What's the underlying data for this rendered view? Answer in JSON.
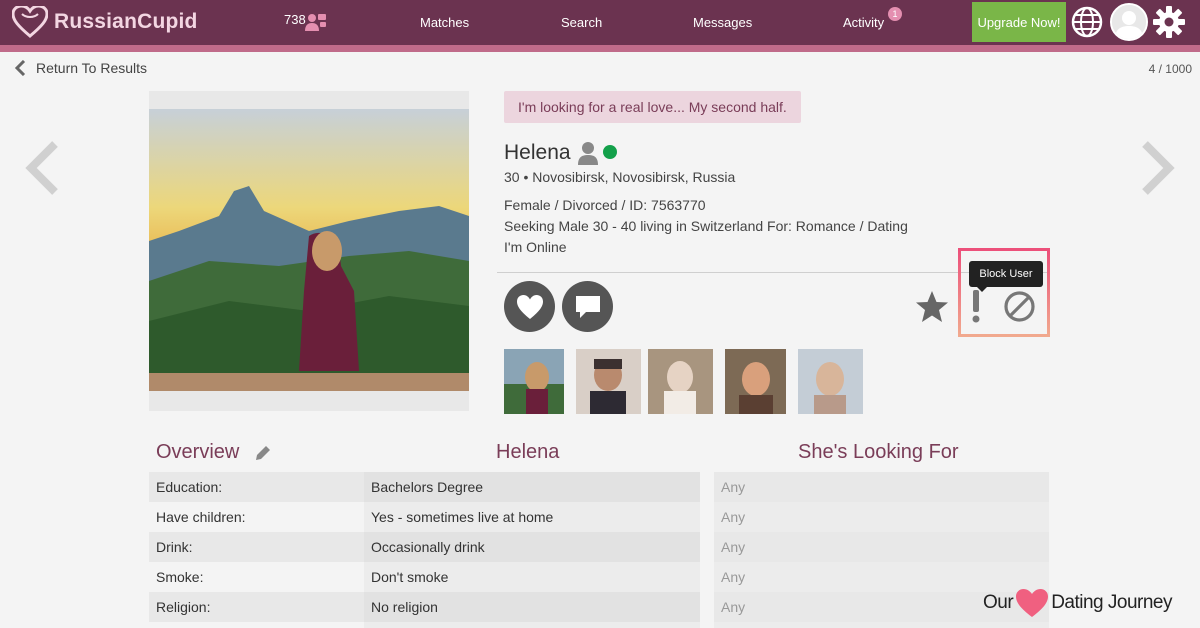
{
  "nav": {
    "logo_text": "RussianCupid",
    "count": "738",
    "matches": "Matches",
    "search": "Search",
    "messages": "Messages",
    "activity": "Activity",
    "activity_badge": "1",
    "upgrade": "Upgrade Now!",
    "icons": [
      "heart-logo-icon",
      "people-icon",
      "globe-icon",
      "avatar-icon",
      "gear-icon"
    ]
  },
  "subheader": {
    "back": "Return To Results",
    "pager": "4 / 1000"
  },
  "profile": {
    "tagline": "I'm looking for a real love... My second half.",
    "name": "Helena",
    "location": "30 • Novosibirsk, Novosibirsk, Russia",
    "details": "Female / Divorced / ID: 7563770",
    "seeking": "Seeking Male 30 - 40 living in Switzerland For: Romance / Dating",
    "status": "I'm Online"
  },
  "actions": {
    "tooltip": "Block User"
  },
  "columns": {
    "overview": "Overview",
    "her": "Helena",
    "looking": "She's Looking For"
  },
  "rows": [
    {
      "label": "Education:",
      "value": "Bachelors Degree",
      "want": "Any"
    },
    {
      "label": "Have children:",
      "value": "Yes - sometimes live at home",
      "want": "Any"
    },
    {
      "label": "Drink:",
      "value": "Occasionally drink",
      "want": "Any"
    },
    {
      "label": "Smoke:",
      "value": "Don't smoke",
      "want": "Any"
    },
    {
      "label": "Religion:",
      "value": "No religion",
      "want": "Any"
    }
  ],
  "watermark": {
    "left": "Our",
    "right": "Dating Journey"
  },
  "colors": {
    "nav_bg": "#6b3350",
    "accent": "#7a3d58",
    "upgrade": "#7ab648",
    "online": "#13a04a"
  }
}
